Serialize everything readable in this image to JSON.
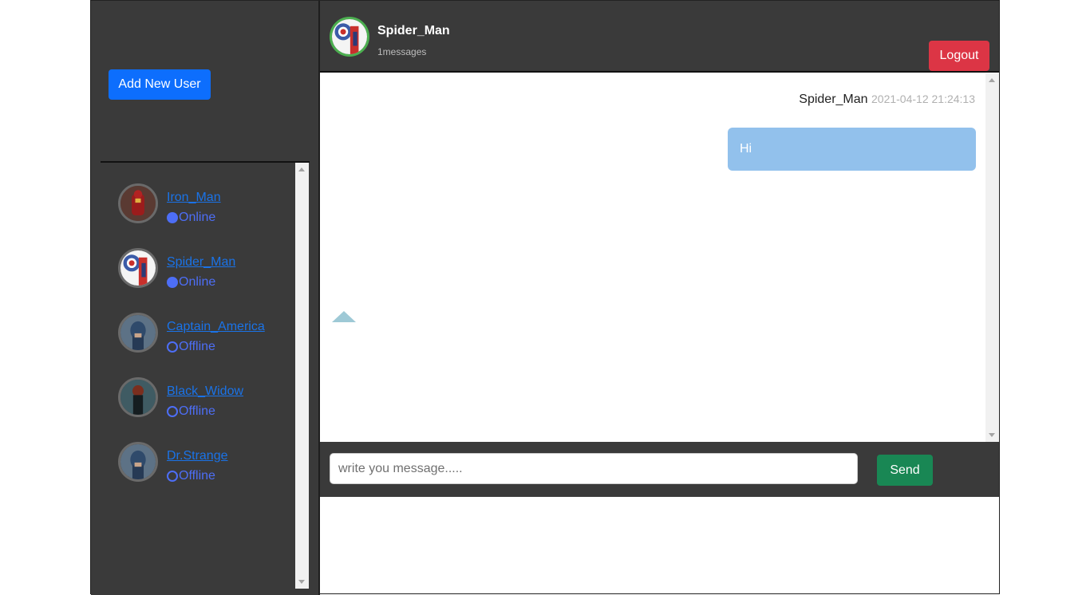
{
  "sidebar": {
    "add_user_label": "Add New User",
    "users": [
      {
        "name": "Iron_Man",
        "status": "Online",
        "online": true,
        "avatar_color": "#8b1e1e"
      },
      {
        "name": "Spider_Man",
        "status": "Online",
        "online": true,
        "avatar_color": "#c9302c"
      },
      {
        "name": "Captain_America",
        "status": "Offline",
        "online": false,
        "avatar_color": "#2f4a6b"
      },
      {
        "name": "Black_Widow",
        "status": "Offline",
        "online": false,
        "avatar_color": "#22343a"
      },
      {
        "name": "Dr.Strange",
        "status": "Offline",
        "online": false,
        "avatar_color": "#2f4a6b"
      }
    ]
  },
  "header": {
    "name": "Spider_Man",
    "message_count": "1messages",
    "logout_label": "Logout"
  },
  "messages": [
    {
      "sender": "Spider_Man",
      "time": "2021-04-12 21:24:13",
      "text": "Hi"
    }
  ],
  "composer": {
    "placeholder": "write you message.....",
    "send_label": "Send"
  },
  "colors": {
    "panel": "#3a3a3a",
    "primary": "#0d6efd",
    "danger": "#dc3545",
    "success": "#198754",
    "bubble": "#92c1ec",
    "status": "#4d6ef6"
  }
}
